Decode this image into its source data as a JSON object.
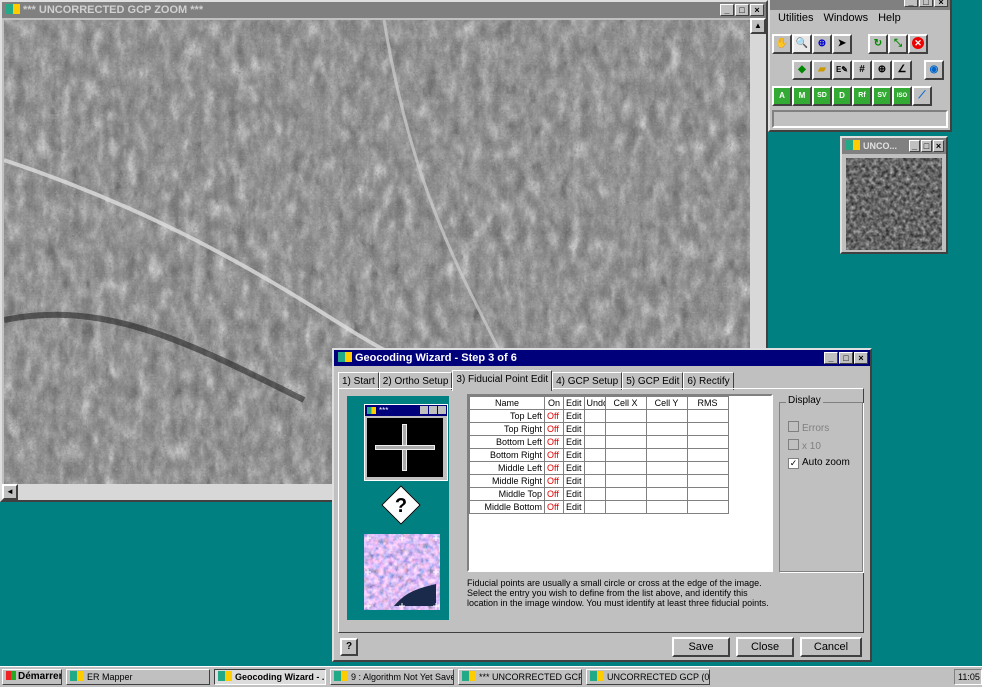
{
  "zoom_window": {
    "title": "*** UNCORRECTED GCP ZOOM ***"
  },
  "main_menu": {
    "items": [
      "Utilities",
      "Windows",
      "Help"
    ]
  },
  "toolbar": {
    "row2": [
      "hand-icon",
      "zoom-icon",
      "zoom-box-icon",
      "pointer-icon",
      "refresh-icon",
      "resize-icon",
      "stop-icon"
    ],
    "row3": [
      "layers-icon",
      "open-icon",
      "edit-icon",
      "grid-icon",
      "crosshair-icon",
      "chart-icon",
      "globe-icon"
    ],
    "row4_labels": [
      "A",
      "M",
      "SD",
      "D",
      "Rf",
      "SV",
      "ISO",
      "~"
    ]
  },
  "overview_window": {
    "title": "UNCO..."
  },
  "wizard": {
    "title": "Geocoding Wizard - Step 3 of 6",
    "tabs": [
      "1) Start",
      "2) Ortho Setup",
      "3) Fiducial Point Edit",
      "4) GCP Setup",
      "5) GCP Edit",
      "6) Rectify"
    ],
    "mini_window_title": "***",
    "table_headers": [
      "Name",
      "On",
      "Edit",
      "Undo",
      "Cell X",
      "Cell Y",
      "RMS"
    ],
    "rows": [
      {
        "name": "Top Left",
        "on": "Off",
        "edit": "Edit"
      },
      {
        "name": "Top Right",
        "on": "Off",
        "edit": "Edit"
      },
      {
        "name": "Bottom Left",
        "on": "Off",
        "edit": "Edit"
      },
      {
        "name": "Bottom Right",
        "on": "Off",
        "edit": "Edit"
      },
      {
        "name": "Middle Left",
        "on": "Off",
        "edit": "Edit"
      },
      {
        "name": "Middle Right",
        "on": "Off",
        "edit": "Edit"
      },
      {
        "name": "Middle Top",
        "on": "Off",
        "edit": "Edit"
      },
      {
        "name": "Middle Bottom",
        "on": "Off",
        "edit": "Edit"
      }
    ],
    "display_group": {
      "label": "Display",
      "errors": "Errors",
      "x10": "x 10",
      "auto_zoom": "Auto zoom",
      "auto_zoom_checked": true
    },
    "help_text": "Fiducial points are usually a small circle or cross at the edge of the image. Select the entry you wish to define from the list above, and identify this location in the image window. You must identify at least three fiducial points.",
    "buttons": {
      "help": "?",
      "save": "Save",
      "close": "Close",
      "cancel": "Cancel"
    }
  },
  "taskbar": {
    "start": "Démarrer",
    "tasks": [
      "ER Mapper",
      "Geocoding Wizard - ...",
      "9 : Algorithm Not Yet Saved",
      "*** UNCORRECTED GCP ...",
      "UNCORRECTED GCP (0..."
    ],
    "clock": "11:05"
  }
}
